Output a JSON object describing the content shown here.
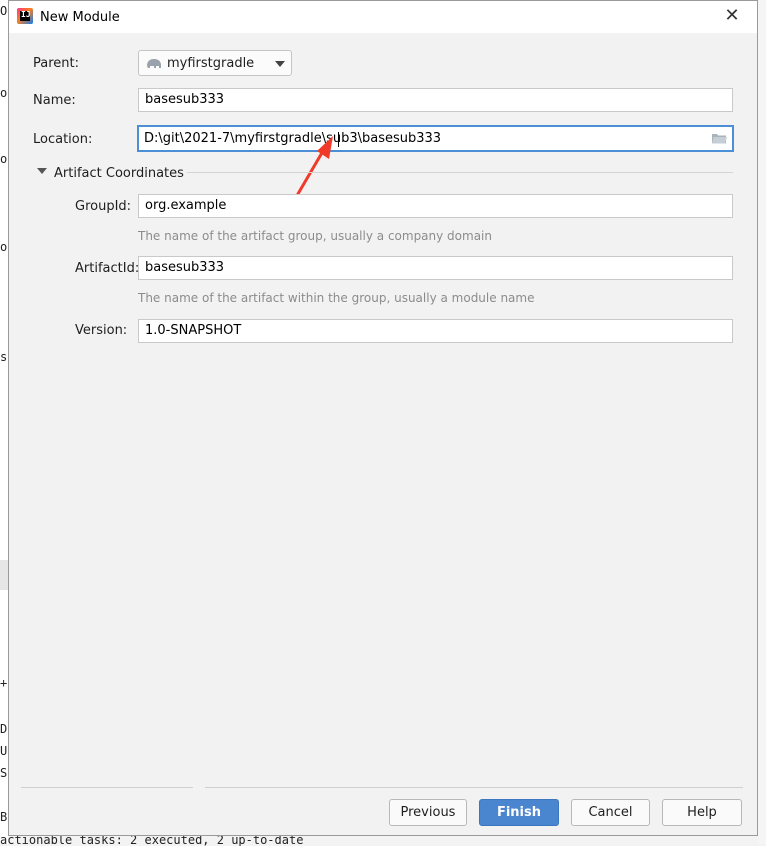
{
  "window": {
    "title": "New Module"
  },
  "form": {
    "parent_label": "Parent:",
    "parent_value": "myfirstgradle",
    "name_label": "Name:",
    "name_value": "basesub333",
    "location_label": "Location:",
    "location_value": "D:\\git\\2021-7\\myfirstgradle\\sub3\\basesub333"
  },
  "artifact": {
    "section_title": "Artifact Coordinates",
    "group_label": "GroupId:",
    "group_value": "org.example",
    "group_hint": "The name of the artifact group, usually a company domain",
    "artifact_label": "ArtifactId:",
    "artifact_value": "basesub333",
    "artifact_hint": "The name of the artifact within the group, usually a module name",
    "version_label": "Version:",
    "version_value": "1.0-SNAPSHOT"
  },
  "buttons": {
    "previous": "Previous",
    "finish": "Finish",
    "cancel": "Cancel",
    "help": "Help"
  },
  "background": {
    "console_line": "actionable tasks: 2 executed, 2 up-to-date"
  },
  "colors": {
    "accent": "#4a86d0",
    "annotation_arrow": "#f03a2a"
  },
  "icons": {
    "app": "intellij-icon",
    "parent": "elephant-icon",
    "browse": "folder-icon",
    "close": "close-icon",
    "collapse": "triangle-down-icon"
  }
}
